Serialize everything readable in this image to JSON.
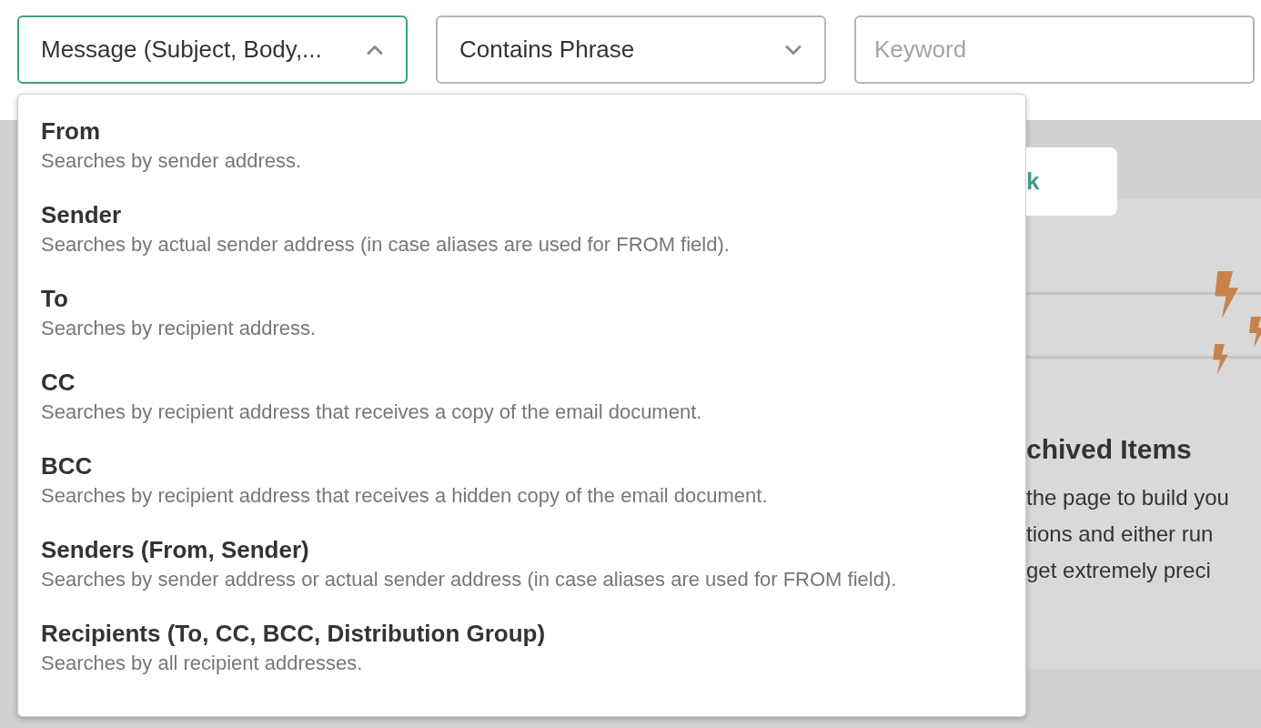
{
  "filters": [
    {
      "kind": "select",
      "value": "Message (Subject, Body,...",
      "expanded": true
    },
    {
      "kind": "select",
      "value": "Contains Phrase",
      "expanded": false
    },
    {
      "kind": "input",
      "placeholder": "Keyword"
    }
  ],
  "dropdown": {
    "options": [
      {
        "title": "From",
        "description": "Searches by sender address."
      },
      {
        "title": "Sender",
        "description": "Searches by actual sender address (in case aliases are used for FROM field)."
      },
      {
        "title": "To",
        "description": "Searches by recipient address."
      },
      {
        "title": "CC",
        "description": "Searches by recipient address that receives a copy of the email document."
      },
      {
        "title": "BCC",
        "description": "Searches by recipient address that receives a hidden copy of the email document."
      },
      {
        "title": "Senders (From, Sender)",
        "description": "Searches by sender address or actual sender address (in case aliases are used for FROM field)."
      },
      {
        "title": "Recipients (To, CC, BCC, Distribution Group)",
        "description": "Searches by all recipient addresses."
      }
    ]
  },
  "background": {
    "tab": "k",
    "heading": "chived Items",
    "lines": [
      "the page to build you",
      "tions and either run",
      "get extremely preci"
    ]
  }
}
